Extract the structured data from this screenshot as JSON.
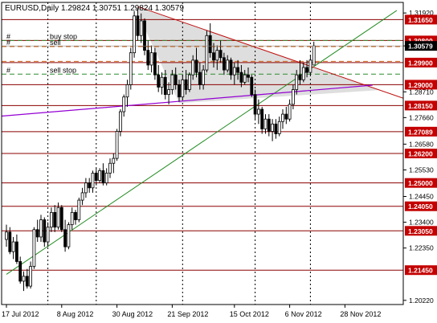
{
  "chart_data": {
    "type": "candlestick",
    "header": "EURUSD,Daily  1.29824 1.30751 1.29824 1.30579",
    "colors": {
      "background": "#ffffff",
      "candle": "#000000",
      "level_line": "#8b0000",
      "level_label_bg": "#c40000",
      "current_label_bg": "#000000",
      "trendline_green": "#228b22",
      "trendline_red": "#c01010",
      "trendline_purple": "#9400d3",
      "order_buy": "#2e8b2e",
      "order_sell": "#d2691e",
      "triangle_fill": "#d3d3d3",
      "grid_dotted": "#000000"
    },
    "y_range": [
      1.2005,
      1.3235
    ],
    "y_ticks": [
      {
        "value": 1.3192,
        "label": "1.31920"
      },
      {
        "value": 1.3058,
        "label": "1.30579"
      },
      {
        "value": 1.2871,
        "label": "1.28710"
      },
      {
        "value": 1.2766,
        "label": "1.27660"
      },
      {
        "value": 1.2658,
        "label": "1.26580"
      },
      {
        "value": 1.2553,
        "label": "1.25530"
      },
      {
        "value": 1.2445,
        "label": "1.24450"
      },
      {
        "value": 1.234,
        "label": "1.23400"
      },
      {
        "value": 1.2235,
        "label": "1.22350"
      },
      {
        "value": 1.2022,
        "label": "1.20220"
      }
    ],
    "levels": [
      {
        "value": 1.3165,
        "label": "1.31650"
      },
      {
        "value": 1.308,
        "label": "1.30800"
      },
      {
        "value": 1.299,
        "label": "1.29900"
      },
      {
        "value": 1.29,
        "label": "1.29000"
      },
      {
        "value": 1.2815,
        "label": "1.28150"
      },
      {
        "value": 1.27089,
        "label": "1.27089"
      },
      {
        "value": 1.262,
        "label": "1.26200"
      },
      {
        "value": 1.25,
        "label": "1.25000"
      },
      {
        "value": 1.2405,
        "label": "1.24050"
      },
      {
        "value": 1.2305,
        "label": "1.23050"
      },
      {
        "value": 1.2145,
        "label": "1.21450"
      }
    ],
    "current_price": {
      "value": 1.30579,
      "label": "1.30579"
    },
    "orders": [
      {
        "value": 1.308,
        "label": "buy stop",
        "marker": "#",
        "kind": "buy"
      },
      {
        "value": 1.3055,
        "label": "sell",
        "marker": "#",
        "kind": "sell"
      },
      {
        "value": 1.2995,
        "label": "",
        "marker": "",
        "kind": "sell"
      },
      {
        "value": 1.2943,
        "label": "sell stop",
        "marker": "#",
        "kind": "buy"
      }
    ],
    "x_labels": [
      {
        "index": 0,
        "label": "17 Jul 2012"
      },
      {
        "index": 16,
        "label": "8 Aug 2012"
      },
      {
        "index": 32,
        "label": "30 Aug 2012"
      },
      {
        "index": 48,
        "label": "21 Sep 2012"
      },
      {
        "index": 66,
        "label": "15 Oct 2012"
      },
      {
        "index": 82,
        "label": "6 Nov 2012"
      },
      {
        "index": 98,
        "label": "28 Nov 2012"
      }
    ],
    "vlines": [
      12,
      26,
      51,
      72,
      88
    ],
    "candles": [
      [
        1.227,
        1.233,
        1.224,
        1.23
      ],
      [
        1.23,
        1.232,
        1.221,
        1.222
      ],
      [
        1.222,
        1.228,
        1.219,
        1.226
      ],
      [
        1.226,
        1.229,
        1.217,
        1.218
      ],
      [
        1.218,
        1.22,
        1.209,
        1.21
      ],
      [
        1.21,
        1.214,
        1.206,
        1.212
      ],
      [
        1.212,
        1.215,
        1.207,
        1.208
      ],
      [
        1.208,
        1.218,
        1.207,
        1.216
      ],
      [
        1.216,
        1.232,
        1.215,
        1.231
      ],
      [
        1.231,
        1.235,
        1.226,
        1.228
      ],
      [
        1.228,
        1.237,
        1.226,
        1.235
      ],
      [
        1.235,
        1.236,
        1.224,
        1.226
      ],
      [
        1.226,
        1.234,
        1.224,
        1.232
      ],
      [
        1.232,
        1.24,
        1.23,
        1.238
      ],
      [
        1.238,
        1.241,
        1.23,
        1.232
      ],
      [
        1.232,
        1.242,
        1.231,
        1.24
      ],
      [
        1.24,
        1.241,
        1.23,
        1.231
      ],
      [
        1.231,
        1.235,
        1.222,
        1.224
      ],
      [
        1.224,
        1.234,
        1.223,
        1.233
      ],
      [
        1.233,
        1.24,
        1.231,
        1.238
      ],
      [
        1.238,
        1.239,
        1.233,
        1.235
      ],
      [
        1.235,
        1.244,
        1.234,
        1.243
      ],
      [
        1.243,
        1.248,
        1.241,
        1.246
      ],
      [
        1.246,
        1.252,
        1.244,
        1.25
      ],
      [
        1.25,
        1.252,
        1.246,
        1.248
      ],
      [
        1.248,
        1.255,
        1.246,
        1.254
      ],
      [
        1.254,
        1.256,
        1.249,
        1.251
      ],
      [
        1.251,
        1.256,
        1.25,
        1.255
      ],
      [
        1.255,
        1.258,
        1.249,
        1.25
      ],
      [
        1.25,
        1.256,
        1.249,
        1.254
      ],
      [
        1.254,
        1.26,
        1.252,
        1.258
      ],
      [
        1.258,
        1.262,
        1.254,
        1.26
      ],
      [
        1.26,
        1.272,
        1.259,
        1.271
      ],
      [
        1.271,
        1.28,
        1.269,
        1.279
      ],
      [
        1.279,
        1.286,
        1.277,
        1.285
      ],
      [
        1.285,
        1.292,
        1.281,
        1.29
      ],
      [
        1.29,
        1.305,
        1.288,
        1.303
      ],
      [
        1.303,
        1.32,
        1.301,
        1.318
      ],
      [
        1.318,
        1.321,
        1.308,
        1.31
      ],
      [
        1.31,
        1.319,
        1.307,
        1.316
      ],
      [
        1.316,
        1.317,
        1.302,
        1.304
      ],
      [
        1.304,
        1.308,
        1.296,
        1.298
      ],
      [
        1.298,
        1.306,
        1.295,
        1.303
      ],
      [
        1.303,
        1.305,
        1.292,
        1.294
      ],
      [
        1.294,
        1.298,
        1.287,
        1.289
      ],
      [
        1.289,
        1.295,
        1.286,
        1.293
      ],
      [
        1.293,
        1.296,
        1.284,
        1.286
      ],
      [
        1.286,
        1.291,
        1.282,
        1.288
      ],
      [
        1.288,
        1.296,
        1.286,
        1.294
      ],
      [
        1.294,
        1.297,
        1.288,
        1.29
      ],
      [
        1.29,
        1.292,
        1.283,
        1.285
      ],
      [
        1.285,
        1.294,
        1.284,
        1.292
      ],
      [
        1.292,
        1.296,
        1.286,
        1.288
      ],
      [
        1.288,
        1.295,
        1.287,
        1.294
      ],
      [
        1.294,
        1.302,
        1.292,
        1.3
      ],
      [
        1.3,
        1.305,
        1.293,
        1.295
      ],
      [
        1.295,
        1.299,
        1.288,
        1.29
      ],
      [
        1.29,
        1.298,
        1.288,
        1.296
      ],
      [
        1.296,
        1.312,
        1.295,
        1.31
      ],
      [
        1.31,
        1.315,
        1.301,
        1.303
      ],
      [
        1.303,
        1.307,
        1.297,
        1.3
      ],
      [
        1.3,
        1.306,
        1.296,
        1.304
      ],
      [
        1.304,
        1.308,
        1.299,
        1.301
      ],
      [
        1.301,
        1.303,
        1.294,
        1.296
      ],
      [
        1.296,
        1.302,
        1.295,
        1.3
      ],
      [
        1.3,
        1.301,
        1.292,
        1.294
      ],
      [
        1.294,
        1.299,
        1.29,
        1.297
      ],
      [
        1.297,
        1.3,
        1.292,
        1.295
      ],
      [
        1.295,
        1.298,
        1.289,
        1.291
      ],
      [
        1.291,
        1.296,
        1.29,
        1.294
      ],
      [
        1.294,
        1.297,
        1.291,
        1.293
      ],
      [
        1.293,
        1.294,
        1.285,
        1.286
      ],
      [
        1.286,
        1.288,
        1.276,
        1.278
      ],
      [
        1.278,
        1.284,
        1.274,
        1.28
      ],
      [
        1.28,
        1.281,
        1.27,
        1.272
      ],
      [
        1.272,
        1.278,
        1.27,
        1.276
      ],
      [
        1.276,
        1.278,
        1.269,
        1.271
      ],
      [
        1.271,
        1.276,
        1.267,
        1.274
      ],
      [
        1.274,
        1.276,
        1.268,
        1.27
      ],
      [
        1.27,
        1.277,
        1.269,
        1.275
      ],
      [
        1.275,
        1.28,
        1.272,
        1.278
      ],
      [
        1.278,
        1.281,
        1.274,
        1.276
      ],
      [
        1.276,
        1.284,
        1.275,
        1.282
      ],
      [
        1.282,
        1.29,
        1.28,
        1.288
      ],
      [
        1.288,
        1.296,
        1.286,
        1.294
      ],
      [
        1.294,
        1.3,
        1.29,
        1.292
      ],
      [
        1.292,
        1.299,
        1.291,
        1.297
      ],
      [
        1.297,
        1.3,
        1.293,
        1.295
      ],
      [
        1.295,
        1.302,
        1.294,
        1.3
      ],
      [
        1.298,
        1.3075,
        1.298,
        1.3058
      ]
    ]
  }
}
